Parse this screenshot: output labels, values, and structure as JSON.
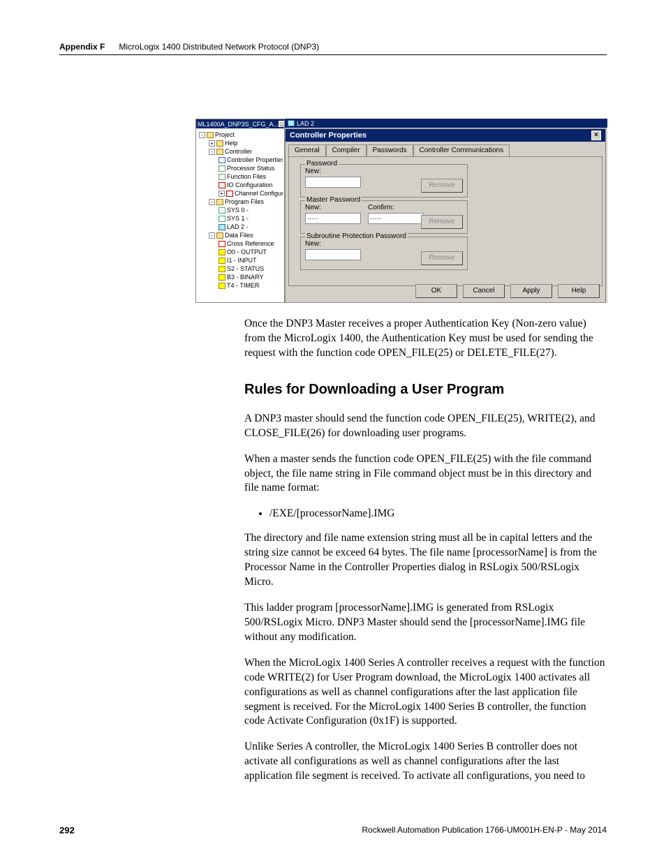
{
  "header": {
    "appendix": "Appendix F",
    "title": "MicroLogix 1400 Distributed Network Protocol (DNP3)"
  },
  "shot": {
    "treetitle": "ML1400A_DNP3S_CFG_A...",
    "ladtab": "LAD 2",
    "tree": {
      "project": "Project",
      "help": "Help",
      "controller": "Controller",
      "controller_props": "Controller Properties",
      "processor_status": "Processor Status",
      "function_files": "Function Files",
      "io_config": "IO Configuration",
      "channel_config": "Channel Configuration",
      "program_files": "Program Files",
      "sys0": "SYS 0 -",
      "sys1": "SYS 1 -",
      "lad2": "LAD 2 -",
      "data_files": "Data Files",
      "cross_ref": "Cross Reference",
      "o0": "O0 - OUTPUT",
      "i1": "I1 - INPUT",
      "s2": "S2 - STATUS",
      "b3": "B3 - BINARY",
      "t4": "T4 - TIMER"
    },
    "dialog_title": "Controller Properties",
    "tabs": {
      "general": "General",
      "compiler": "Compiler",
      "passwords": "Passwords",
      "comms": "Controller Communications"
    },
    "groups": {
      "password": {
        "legend": "Password",
        "new": "New:",
        "remove": "Remove"
      },
      "master": {
        "legend": "Master Password",
        "new": "New:",
        "confirm": "Confirm:",
        "newval": "·····",
        "confval": "·····",
        "remove": "Remove"
      },
      "sub": {
        "legend": "Subroutine Protection Password",
        "new": "New:",
        "remove": "Remove"
      }
    },
    "buttons": {
      "ok": "OK",
      "cancel": "Cancel",
      "apply": "Apply",
      "help": "Help"
    }
  },
  "para1": "Once the DNP3 Master receives a proper Authentication Key (Non-zero value) from the MicroLogix 1400, the Authentication Key must be used for sending the request with the function code OPEN_FILE(25) or DELETE_FILE(27).",
  "heading": "Rules for Downloading a User Program",
  "para2": "A DNP3 master should send the function code OPEN_FILE(25), WRITE(2), and CLOSE_FILE(26) for downloading user programs.",
  "para3": "When a master sends the function code OPEN_FILE(25) with the file command object, the file name string in File command object must be in this directory and file name format:",
  "bullet1": "/EXE/[processorName].IMG",
  "para4": "The directory and file name extension string must all be in capital letters and the string size cannot be exceed 64 bytes. The file name [processorName] is from the Processor Name in the Controller Properties dialog in RSLogix 500/RSLogix Micro.",
  "para5": "This ladder program [processorName].IMG is generated from RSLogix 500/RSLogix Micro. DNP3 Master should send the [processorName].IMG file without any modification.",
  "para6": "When the MicroLogix 1400 Series A controller receives a request with the function code WRITE(2) for User Program download, the MicroLogix 1400 activates all configurations as well as channel configurations after the last application file segment is received. For the MicroLogix 1400 Series B controller, the function code Activate Configuration (0x1F) is supported.",
  "para7": "Unlike Series A controller, the MicroLogix 1400 Series B controller does not activate all configurations as well as channel configurations after the last application file segment is received. To activate all configurations, you need to",
  "footer": {
    "page": "292",
    "pub": "Rockwell Automation Publication 1766-UM001H-EN-P - May 2014"
  }
}
